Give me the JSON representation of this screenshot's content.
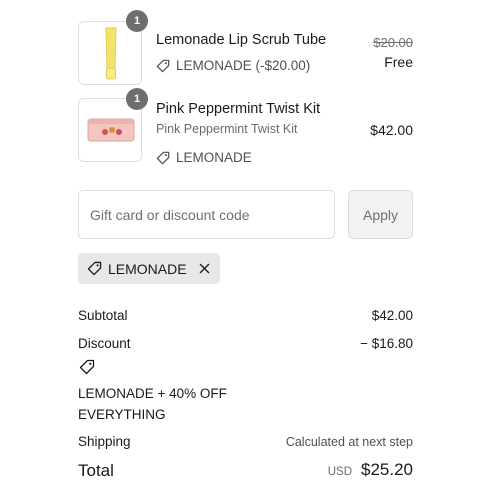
{
  "items": [
    {
      "title": "Lemonade Lip Scrub Tube",
      "quantity": "1",
      "tag": "LEMONADE (-$20.00)",
      "original_price": "$20.00",
      "price": "Free"
    },
    {
      "title": "Pink Peppermint Twist Kit",
      "subtitle": "Pink Peppermint Twist Kit",
      "quantity": "1",
      "tag": "LEMONADE",
      "price": "$42.00"
    }
  ],
  "discount_form": {
    "placeholder": "Gift card or discount code",
    "value": "",
    "apply_label": "Apply"
  },
  "applied_code": {
    "label": "LEMONADE"
  },
  "summary": {
    "subtotal_label": "Subtotal",
    "subtotal_value": "$42.00",
    "discount_label": "Discount",
    "discount_value": "− $16.80",
    "discount_description": "LEMONADE + 40% OFF EVERYTHING",
    "shipping_label": "Shipping",
    "shipping_value": "Calculated at next step",
    "total_label": "Total",
    "currency": "USD",
    "total_value": "$25.20"
  },
  "colors": {
    "badge": "#6e6e6e",
    "chip_bg": "#e8e8e8",
    "lotion_yellow": "#f2e06a",
    "kit_pink": "#f3c6c2"
  }
}
